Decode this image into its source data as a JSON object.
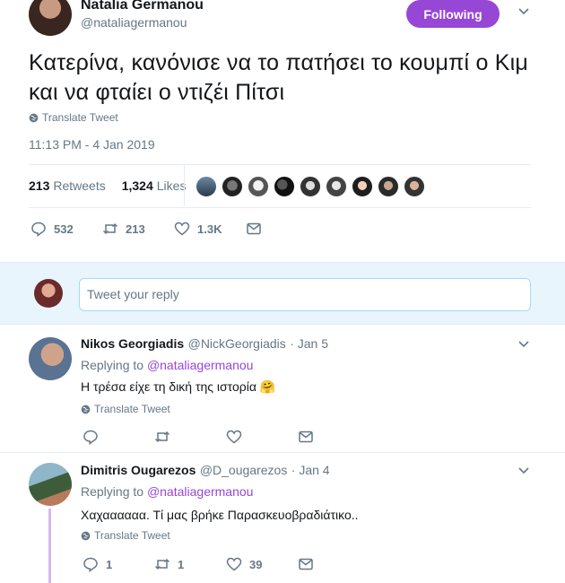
{
  "tweet": {
    "author_name": "Natalia Germanou",
    "author_handle": "@nataliagermanou",
    "follow_label": "Following",
    "text": "Κατερίνα, κανόνισε να το πατήσει το κουμπί ο Κιμ και να φταίει ο ντιζέι Πίτσι",
    "translate_label": "Translate Tweet",
    "timestamp": "11:13 PM - 4 Jan 2019",
    "retweets_count": "213",
    "retweets_label": "Retweets",
    "likes_count": "1,324",
    "likes_label": "Likes",
    "actions": {
      "replies": "532",
      "retweets": "213",
      "likes": "1.3K"
    }
  },
  "compose": {
    "placeholder": "Tweet your reply"
  },
  "replies": [
    {
      "name": "Nikos Georgiadis",
      "handle": "@NickGeorgiadis",
      "date": "· Jan 5",
      "replying_prefix": "Replying to",
      "replying_to": "@nataliagermanou",
      "text": "Η τρέσα είχε τη δική της ιστορία 🤗",
      "translate_label": "Translate Tweet",
      "replies": "",
      "retweets": "",
      "likes": ""
    },
    {
      "name": "Dimitris Ougarezos",
      "handle": "@D_ougarezos",
      "date": "· Jan 4",
      "replying_prefix": "Replying to",
      "replying_to": "@nataliagermanou",
      "text": "Χαχαααααα. Τί μας βρήκε Παρασκευοβραδιάτικο..",
      "translate_label": "Translate Tweet",
      "replies": "1",
      "retweets": "1",
      "likes": "39"
    }
  ],
  "colors": {
    "accent": "#9747d6",
    "muted": "#657786",
    "text": "#14171a",
    "reply_bg": "#e8f5fd"
  }
}
